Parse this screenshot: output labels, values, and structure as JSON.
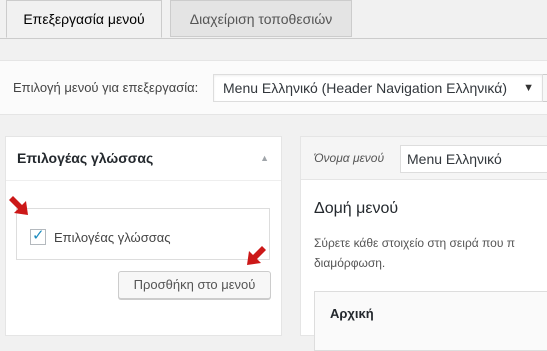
{
  "tabs": [
    {
      "label": "Επεξεργασία μενού"
    },
    {
      "label": "Διαχείριση τοποθεσιών"
    }
  ],
  "menu_select": {
    "label": "Επιλογή μενού για επεξεργασία:",
    "selected": "Menu Ελληνικό (Header Navigation Ελληνικά)",
    "arrow_icon": "chevron-down-icon"
  },
  "left_panel": {
    "title": "Επιλογέας γλώσσας",
    "checkbox_label": "Επιλογέας γλώσσας",
    "checkbox_checked": true,
    "add_button": "Προσθήκη στο μενού"
  },
  "right_panel": {
    "name_label": "Όνομα μενού",
    "name_value": "Menu Ελληνικό",
    "structure_title": "Δομή μενού",
    "structure_desc_line1": "Σύρετε κάθε στοιχείο στη σειρά που π",
    "structure_desc_line2": "διαμόρφωση.",
    "first_item": "Αρχική"
  },
  "colors": {
    "arrow": "#cc1818",
    "accent": "#1e8cbe"
  }
}
